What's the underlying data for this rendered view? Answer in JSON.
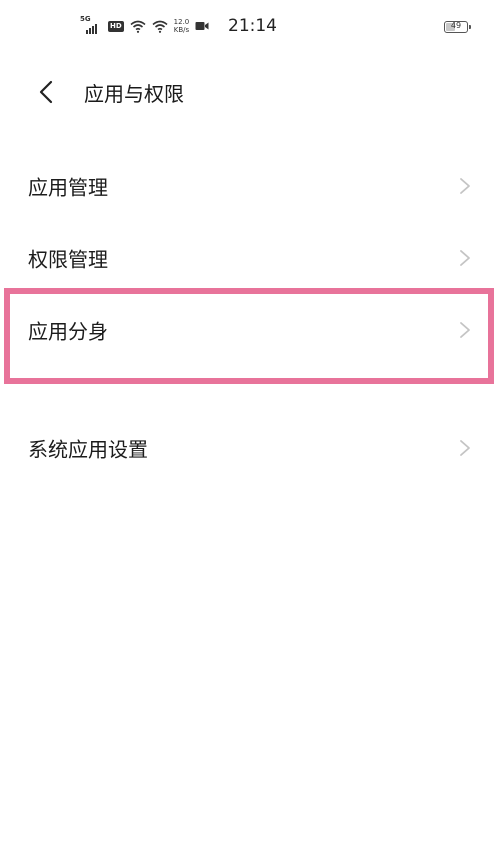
{
  "status_bar": {
    "network_label": "5G",
    "hd_label": "HD",
    "speed_value": "12.0",
    "speed_unit": "KB/s",
    "time": "21:14",
    "battery_level": "49",
    "battery_fraction": 0.49
  },
  "header": {
    "title": "应用与权限"
  },
  "menu": {
    "items": [
      {
        "label": "应用管理"
      },
      {
        "label": "权限管理"
      },
      {
        "label": "应用分身"
      },
      {
        "label": "系统应用设置"
      }
    ]
  },
  "colors": {
    "highlight": "#e8739a",
    "chevron": "#c4c4c4",
    "text": "#1c1c1c"
  }
}
